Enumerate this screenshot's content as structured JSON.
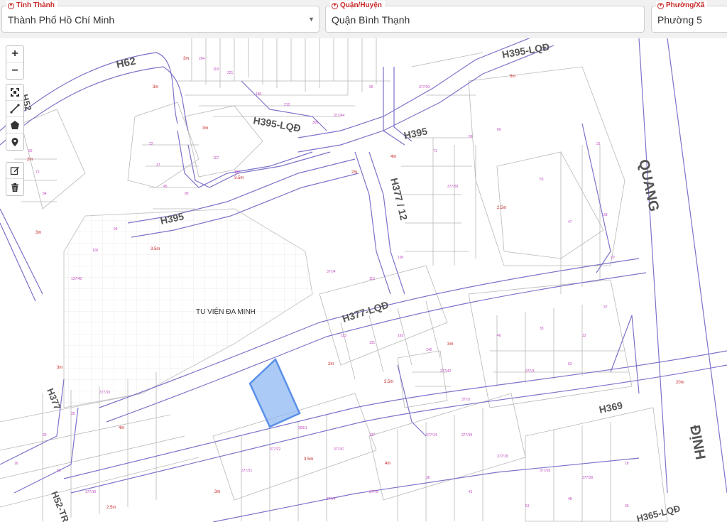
{
  "filters": {
    "province": {
      "label": "Tỉnh Thành",
      "value": "Thành Phố Hồ Chí Minh"
    },
    "district": {
      "label": "Quận/Huyện",
      "value": "Quận Bình Thạnh"
    },
    "ward": {
      "label": "Phường/Xã",
      "value": "Phường 5"
    }
  },
  "toolbar": {
    "zoom_in": "+",
    "zoom_out": "−"
  },
  "map": {
    "place_label": "TU VIỆN ĐA MINH",
    "road_labels": {
      "h62": "H62",
      "h395_lqd_top": "H395-LQĐ",
      "h395_lqd_mid": "H395-LQĐ",
      "h395_mid": "H395",
      "h395_left": "H395",
      "h377_12": "H377 / 12",
      "h377_lqd": "H377-LQĐ",
      "h369": "H369",
      "h377_left": "H377",
      "h52_tr": "H52-TR",
      "h365_lqd": "H365-LQĐ",
      "h52_left": "H52",
      "quang": "QUANG",
      "dinh": "ĐỊNH"
    },
    "widths": [
      "3m",
      "3.5m",
      "2m",
      "4m",
      "3m",
      "3m",
      "2.5m",
      "3.5m",
      "2m",
      "5m",
      "3m",
      "4m",
      "3m",
      "20m",
      "3.5m",
      "2m",
      "3m",
      "3.5m",
      "4m",
      "3m",
      "2.5m"
    ],
    "colors": {
      "parcel": "#b0b0b0",
      "road_edge": "#7b73c9",
      "label_pink": "#c04bc0",
      "width_red": "#c62828",
      "highlight_fill": "#8fb8f2",
      "highlight_stroke": "#5b8fe8"
    }
  }
}
